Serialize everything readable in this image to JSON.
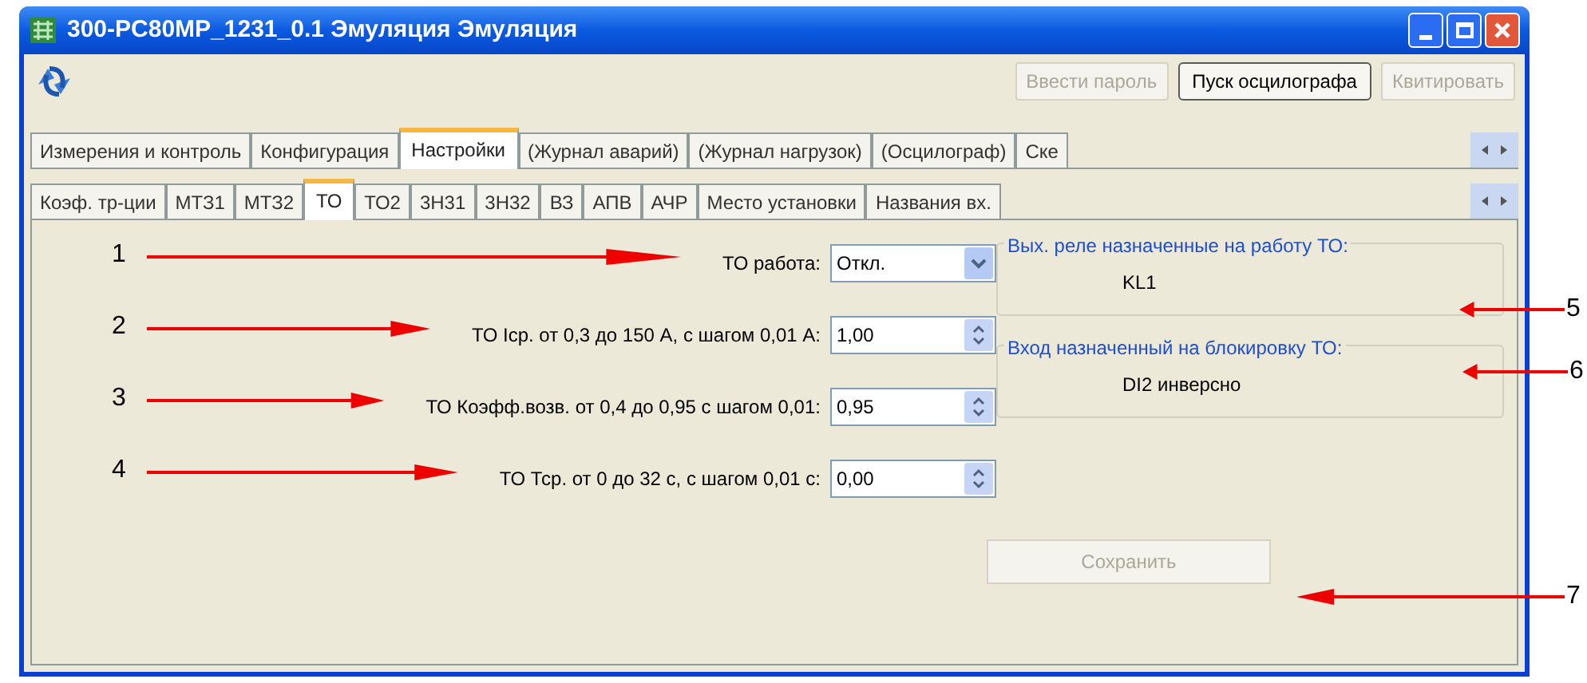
{
  "window": {
    "title": "300-PC80MP_1231_0.1 Эмуляция Эмуляция"
  },
  "toolbar": {
    "buttons": [
      {
        "label": "Ввести пароль",
        "disabled": true
      },
      {
        "label": "Пуск осцилографа",
        "disabled": false
      },
      {
        "label": "Квитировать",
        "disabled": true
      }
    ]
  },
  "tabs": [
    {
      "label": "Измерения и контроль",
      "selected": false
    },
    {
      "label": "Конфигурация",
      "selected": false
    },
    {
      "label": "Настройки",
      "selected": true
    },
    {
      "label": "(Журнал аварий)",
      "selected": false
    },
    {
      "label": "(Журнал нагрузок)",
      "selected": false
    },
    {
      "label": "(Осцилограф)",
      "selected": false
    },
    {
      "label": "Ске",
      "selected": false
    }
  ],
  "subtabs": [
    {
      "label": "Коэф. тр-ции",
      "selected": false
    },
    {
      "label": "МТЗ1",
      "selected": false
    },
    {
      "label": "МТЗ2",
      "selected": false
    },
    {
      "label": "ТО",
      "selected": true
    },
    {
      "label": "ТО2",
      "selected": false
    },
    {
      "label": "3Н31",
      "selected": false
    },
    {
      "label": "3Н32",
      "selected": false
    },
    {
      "label": "ВЗ",
      "selected": false
    },
    {
      "label": "АПВ",
      "selected": false
    },
    {
      "label": "АЧР",
      "selected": false
    },
    {
      "label": "Место установки",
      "selected": false
    },
    {
      "label": "Названия вх.",
      "selected": false
    }
  ],
  "settings": [
    {
      "kind": "select",
      "label": "ТО работа:",
      "value": "Откл."
    },
    {
      "kind": "spin",
      "label": "ТО Iср. от 0,3 до 150 А, с шагом 0,01 А:",
      "value": "1,00"
    },
    {
      "kind": "spin",
      "label": "ТО Коэфф.возв. от 0,4 до 0,95 с шагом 0,01:",
      "value": "0,95"
    },
    {
      "kind": "spin",
      "label": "ТО Тср. от 0 до 32 с, с шагом 0,01 с:",
      "value": "0,00"
    }
  ],
  "groups": [
    {
      "title": "Вых. реле назначенные на работу ТО:",
      "value": "KL1"
    },
    {
      "title": "Вход назначенный на блокировку ТО:",
      "value": "DI2 инверсно"
    }
  ],
  "save_button": {
    "label": "Сохранить",
    "disabled": true
  },
  "callouts": [
    "1",
    "2",
    "3",
    "4",
    "5",
    "6",
    "7"
  ]
}
